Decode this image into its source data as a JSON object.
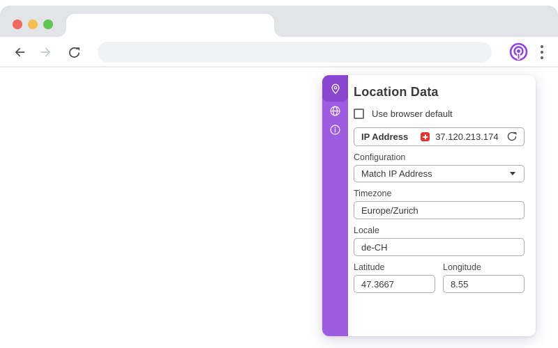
{
  "browser": {
    "window_controls": [
      "close",
      "minimize",
      "maximize"
    ],
    "nav": {
      "back": "back",
      "forward": "forward",
      "reload": "reload"
    },
    "address_value": "",
    "extension_icon": "vytal-location-guard-icon",
    "menu_icon": "kebab-menu-icon"
  },
  "colors": {
    "accent_purple": "#9d5ce2",
    "sidebar_active_purple": "#8a46cf",
    "extension_logo_purple": "#8f45dd",
    "flag_red": "#e3342b",
    "traffic_lights": [
      "#ed6a5f",
      "#f5bf4f",
      "#5fc454"
    ]
  },
  "panel": {
    "title": "Location Data",
    "sidebar": {
      "items": [
        {
          "icon": "location-pin-icon",
          "active": true
        },
        {
          "icon": "globe-icon",
          "active": false
        },
        {
          "icon": "info-icon",
          "active": false
        }
      ]
    },
    "use_browser_default": {
      "label": "Use browser default",
      "checked": false
    },
    "ip": {
      "label": "IP Address",
      "value": "37.120.213.174",
      "flag": "switzerland-flag-icon",
      "refresh": "refresh-icon"
    },
    "configuration": {
      "label": "Configuration",
      "value": "Match IP Address"
    },
    "timezone": {
      "label": "Timezone",
      "value": "Europe/Zurich"
    },
    "locale": {
      "label": "Locale",
      "value": "de-CH"
    },
    "latitude": {
      "label": "Latitude",
      "value": "47.3667"
    },
    "longitude": {
      "label": "Longitude",
      "value": "8.55"
    }
  }
}
